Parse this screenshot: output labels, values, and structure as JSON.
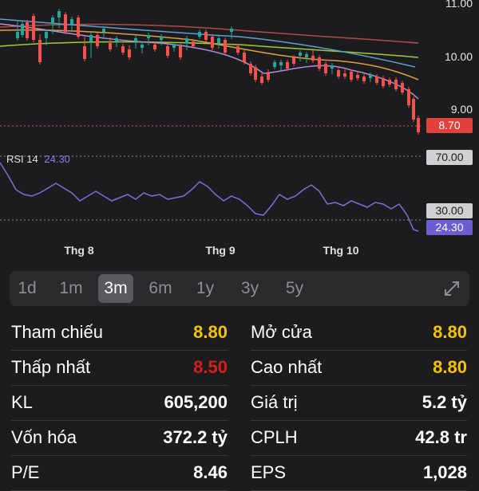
{
  "price_axis": [
    "11.00",
    "10.00",
    "9.00"
  ],
  "current_price_badge": "8.70",
  "rsi": {
    "label": "RSI 14",
    "value": "24.30",
    "upper_badge": "70.00",
    "lower_badge": "30.00",
    "value_badge": "24.30"
  },
  "months": [
    "Thg 8",
    "Thg 9",
    "Thg 10"
  ],
  "timeframes": [
    "1d",
    "1m",
    "3m",
    "6m",
    "1y",
    "3y",
    "5y"
  ],
  "active_timeframe": "3m",
  "colors": {
    "up": "#26a69a",
    "down": "#ef5350",
    "rsi_line": "#7e6cd8",
    "yellow": "#f5c400",
    "red": "#d91c1c"
  },
  "stats_left": [
    {
      "label": "Tham chiếu",
      "value": "8.80",
      "color": "yellow"
    },
    {
      "label": "Thấp nhất",
      "value": "8.50",
      "color": "red"
    },
    {
      "label": "KL",
      "value": "605,200",
      "color": "white"
    },
    {
      "label": "Vốn hóa",
      "value": "372.2 tỷ",
      "color": "white"
    },
    {
      "label": "P/E",
      "value": "8.46",
      "color": "white"
    }
  ],
  "stats_right": [
    {
      "label": "Mở cửa",
      "value": "8.80",
      "color": "yellow"
    },
    {
      "label": "Cao nhất",
      "value": "8.80",
      "color": "yellow"
    },
    {
      "label": "Giá trị",
      "value": "5.2 tỷ",
      "color": "white"
    },
    {
      "label": "CPLH",
      "value": "42.8 tr",
      "color": "white"
    },
    {
      "label": "EPS",
      "value": "1,028",
      "color": "white"
    }
  ],
  "icons": {
    "expand": "expand-arrows-icon"
  }
}
